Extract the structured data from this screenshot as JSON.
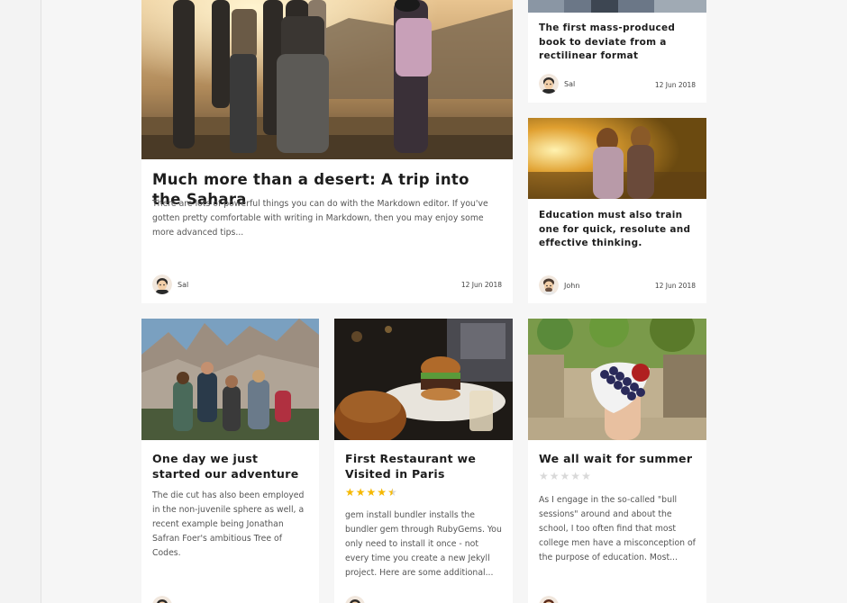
{
  "posts": {
    "sahara": {
      "title": "Much more than a desert: A trip into the Sahara",
      "excerpt": "There are lots of powerful things you can do with the Markdown editor. If you've gotten pretty comfortable with writing in Markdown, then you may enjoy some more advanced tips...",
      "author": "Sal",
      "date": "12 Jun 2018"
    },
    "book": {
      "title": "The first mass-produced book to deviate from a rectilinear format",
      "author": "Sal",
      "date": "12 Jun 2018"
    },
    "education": {
      "title": "Education must also train one for quick, resolute and effective thinking.",
      "author": "John",
      "date": "12 Jun 2018"
    },
    "adventure": {
      "title": "One day we just started our adventure",
      "excerpt": "The die cut has also been employed in the non-juvenile sphere as well, a recent example being Jonathan Safran Foer's ambitious Tree of Codes."
    },
    "restaurant": {
      "title": "First Restaurant we Visited in Paris",
      "rating": 4.5,
      "stars": [
        "★",
        "★",
        "★",
        "★",
        "★"
      ],
      "excerpt": "gem install bundler installs the bundler gem through RubyGems. You only need to install it once - not every time you create a new Jekyll project. Here are some additional..."
    },
    "summer": {
      "title": "We all wait for summer",
      "rating": 0,
      "stars": [
        "★",
        "★",
        "★",
        "★",
        "★"
      ],
      "excerpt": "As I engage in the so-called \"bull sessions\" around and about the school, I too often find that most college men have a misconception of the purpose of education. Most..."
    }
  },
  "colors": {
    "star_filled": "#f5b800",
    "star_empty": "#d9d9d9",
    "title_text": "#1d1d1d",
    "page_background": "#f6f6f6"
  }
}
